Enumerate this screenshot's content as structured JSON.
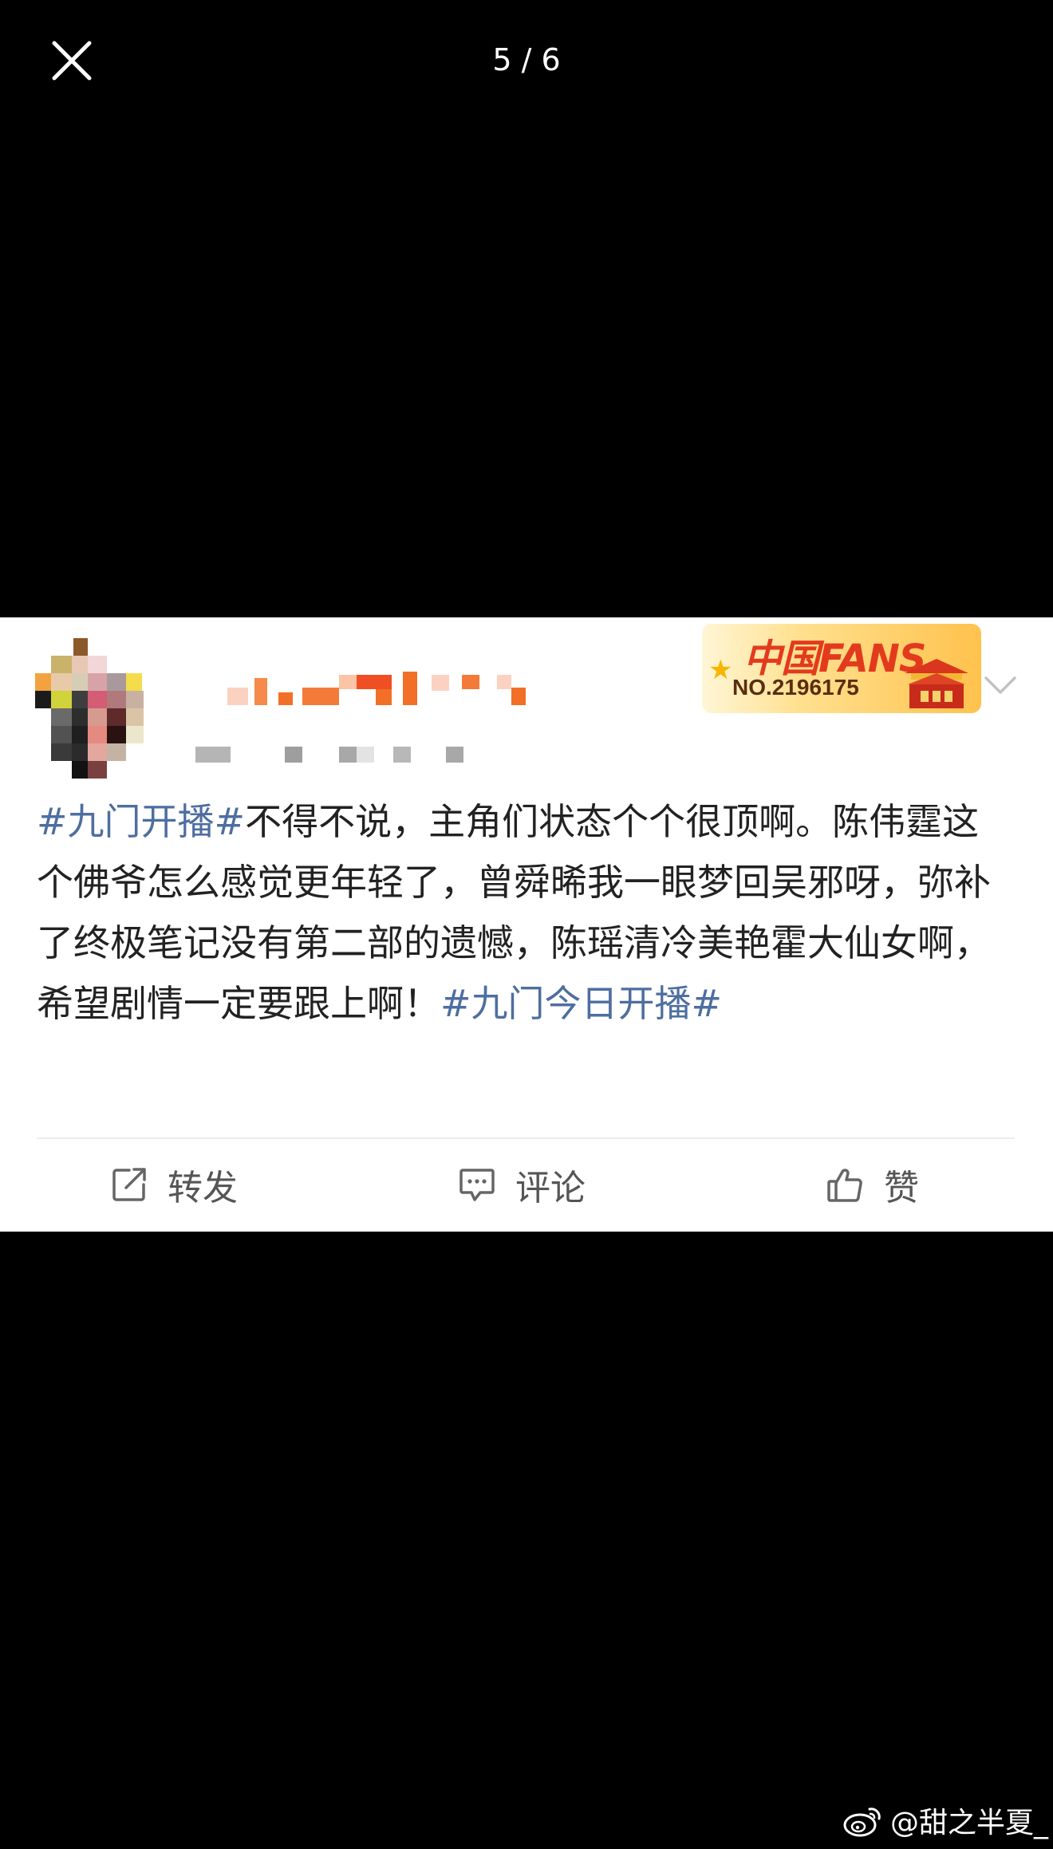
{
  "viewer": {
    "pager_text": "5 / 6"
  },
  "post": {
    "fans_badge": {
      "title": "中国FANS",
      "number": "NO.2196175"
    },
    "text": {
      "hashtag_1": "#九门开播#",
      "body": "不得不说，主角们状态个个很顶啊。陈伟霆这个佛爷怎么感觉更年轻了，曾舜晞我一眼梦回吴邪呀，弥补了终极笔记没有第二部的遗憾，陈瑶清冷美艳霍大仙女啊，希望剧情一定要跟上啊！",
      "hashtag_2": "#九门今日开播#"
    },
    "actions": {
      "repost": "转发",
      "comment": "评论",
      "like": "赞"
    }
  },
  "watermark": {
    "text": "@甜之半夏_"
  },
  "colors": {
    "background": "#000000",
    "card": "#ffffff",
    "hashtag": "#4e6ea0",
    "text": "#222222",
    "action": "#555555"
  }
}
